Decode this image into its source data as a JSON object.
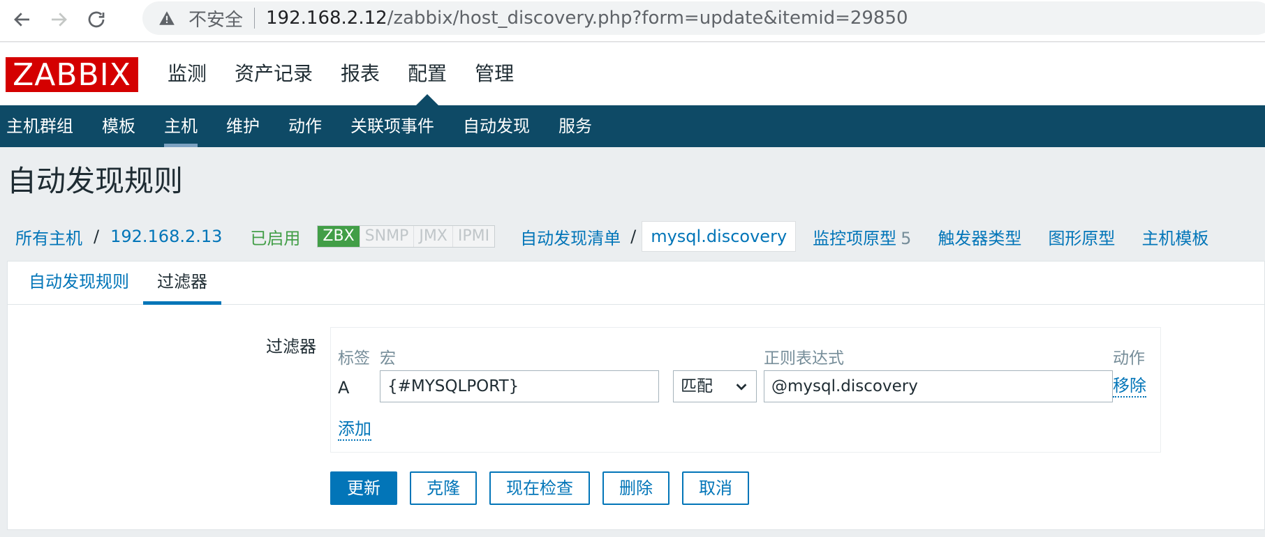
{
  "browser": {
    "insecure_label": "不安全",
    "url_host": "192.168.2.12",
    "url_path": "/zabbix/host_discovery.php?form=update&itemid=29850"
  },
  "logo": "ZABBIX",
  "main_menu": [
    "监测",
    "资产记录",
    "报表",
    "配置",
    "管理"
  ],
  "sub_menu": [
    "主机群组",
    "模板",
    "主机",
    "维护",
    "动作",
    "关联项事件",
    "自动发现",
    "服务"
  ],
  "page_title": "自动发现规则",
  "breadcrumb": {
    "all_hosts": "所有主机",
    "sep": "/",
    "host": "192.168.2.13",
    "enabled": "已启用",
    "status_tags": [
      "ZBX",
      "SNMP",
      "JMX",
      "IPMI"
    ],
    "discovery_list": "自动发现清单",
    "current": "mysql.discovery",
    "item_prototypes": "监控项原型",
    "item_prototypes_count": "5",
    "trigger_prototypes": "触发器类型",
    "graph_prototypes": "图形原型",
    "host_prototypes": "主机模板"
  },
  "tabs": [
    "自动发现规则",
    "过滤器"
  ],
  "filter": {
    "label": "过滤器",
    "headers": {
      "label": "标签",
      "macro": "宏",
      "regex": "正则表达式",
      "action": "动作"
    },
    "row": {
      "letter": "A",
      "macro": "{#MYSQLPORT}",
      "operator": "匹配",
      "regex": "@mysql.discovery",
      "remove": "移除"
    },
    "add": "添加"
  },
  "buttons": {
    "update": "更新",
    "clone": "克隆",
    "check_now": "现在检查",
    "delete": "删除",
    "cancel": "取消"
  }
}
